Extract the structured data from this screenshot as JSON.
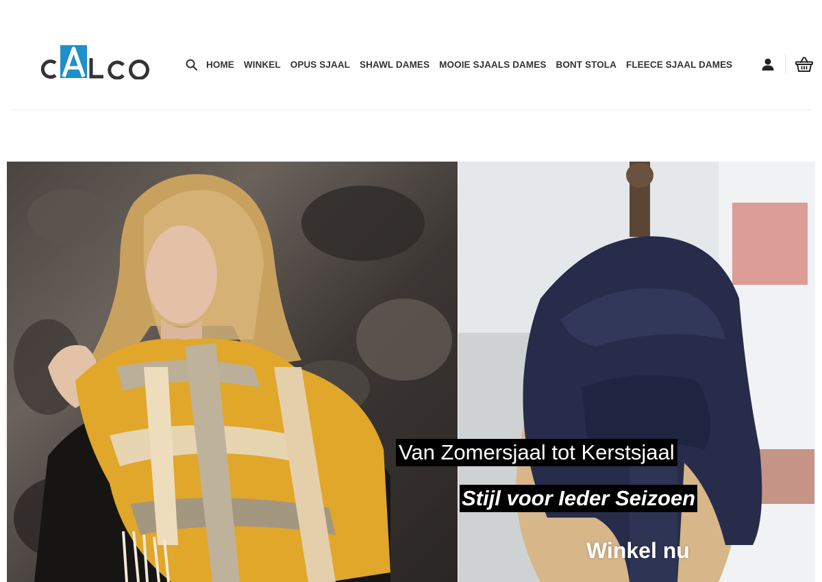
{
  "brand": {
    "logo_text": "cALco",
    "accent_color": "#1e8fc8",
    "text_color": "#333333"
  },
  "nav": {
    "search_icon": "search-icon",
    "items": [
      {
        "label": "HOME"
      },
      {
        "label": "WINKEL"
      },
      {
        "label": "OPUS SJAAL"
      },
      {
        "label": "SHAWL DAMES"
      },
      {
        "label": "MOOIE SJAALS DAMES"
      },
      {
        "label": "BONT STOLA"
      },
      {
        "label": "FLEECE SJAAL DAMES"
      }
    ]
  },
  "header_actions": {
    "account_icon": "user-icon",
    "cart_icon": "basket-icon"
  },
  "hero": {
    "title": "Van Zomersjaal tot Kerstsjaal",
    "subtitle": "Stijl voor Ieder Seizoen",
    "cta": "Winkel nu",
    "left_image": "woman-with-yellow-plaid-scarf",
    "right_image": "navy-knit-scarf-on-mannequin"
  }
}
